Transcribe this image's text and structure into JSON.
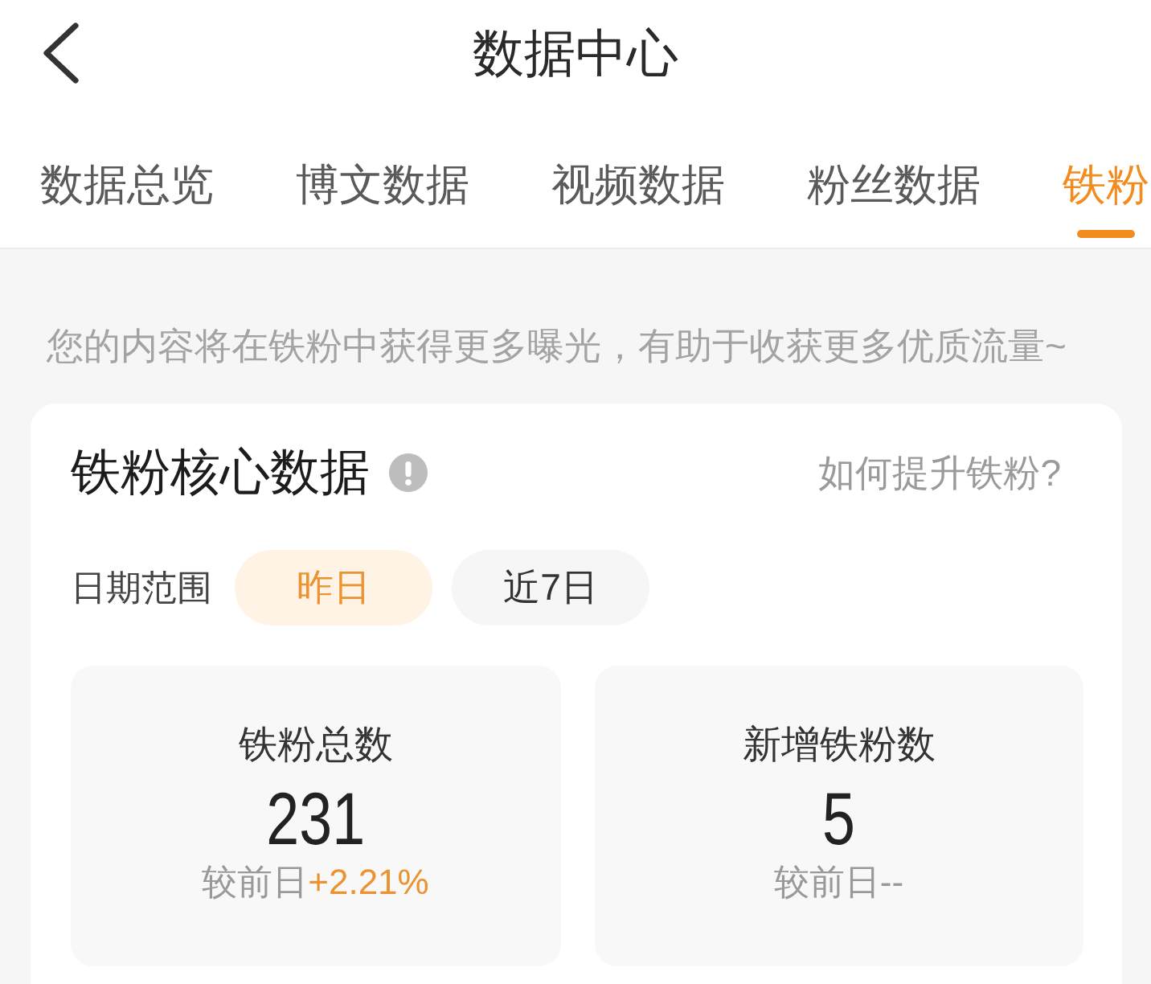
{
  "header": {
    "title": "数据中心"
  },
  "tabs": [
    {
      "label": "数据总览",
      "selected": false
    },
    {
      "label": "博文数据",
      "selected": false
    },
    {
      "label": "视频数据",
      "selected": false
    },
    {
      "label": "粉丝数据",
      "selected": false
    },
    {
      "label": "铁粉",
      "selected": true
    }
  ],
  "notice": "您的内容将在铁粉中获得更多曝光，有助于收获更多优质流量~",
  "core_card": {
    "title": "铁粉核心数据",
    "help_link": "如何提升铁粉?",
    "date_range": {
      "label": "日期范围",
      "options": [
        {
          "label": "昨日",
          "selected": true
        },
        {
          "label": "近7日",
          "selected": false
        }
      ]
    },
    "stats": [
      {
        "label": "铁粉总数",
        "value": "231",
        "compare": "较前日",
        "change": "+2.21%",
        "change_highlighted": true
      },
      {
        "label": "新增铁粉数",
        "value": "5",
        "compare": "较前日",
        "change": "--",
        "change_highlighted": false
      }
    ]
  }
}
